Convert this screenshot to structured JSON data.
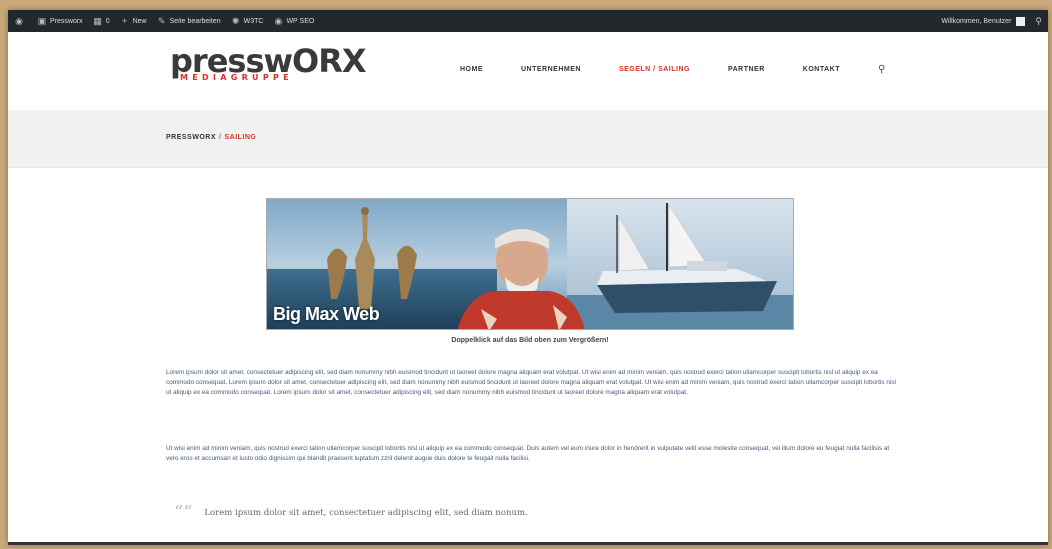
{
  "adminbar": {
    "items": [
      {
        "icon": "wordpress-icon",
        "label": ""
      },
      {
        "icon": "dashboard-icon",
        "label": "Pressworx"
      },
      {
        "icon": "comments-icon",
        "label": "0"
      },
      {
        "icon": "plus-icon",
        "label": "New"
      },
      {
        "icon": "edit-icon",
        "label": "Seite bearbeiten"
      },
      {
        "icon": "w3tc-icon",
        "label": "W3TC"
      },
      {
        "icon": "seo-icon",
        "label": "WP SEO"
      }
    ],
    "greeting": "Willkommen, Benutzer"
  },
  "header": {
    "logo_main": "presswORX",
    "logo_sub": "MEDIAGRUPPE",
    "nav": [
      {
        "label": "HOME",
        "active": false
      },
      {
        "label": "UNTERNEHMEN",
        "active": false
      },
      {
        "label": "SEGELN / SAILING",
        "active": true
      },
      {
        "label": "PARTNER",
        "active": false
      },
      {
        "label": "KONTAKT",
        "active": false
      }
    ]
  },
  "breadcrumb": {
    "home": "PRESSWORX",
    "separator": "/",
    "current": "SAILING"
  },
  "content": {
    "banner_text": "Big Max Web",
    "caption": "Doppelklick auf das Bild oben zum Vergrößern!",
    "paragraph1": "Lorem ipsum dolor sit amet, consectetuer adipiscing elit, sed diam nonummy nibh euismod tincidunt ut laoreet dolore magna aliquam erat volutpat. Ut wisi enim ad minim veniam, quis nostrud exerci tation ullamcorper suscipit lobortis nisl ut aliquip ex ea commodo consequat. Lorem ipsum dolor sit amet, consectetuer adipiscing elit, sed diam nonummy nibh euismod tincidunt ut laoreet dolore magna aliquam erat volutpat. Ut wisi enim ad minim veniam, quis nostrud exerci tation ullamcorper suscipit lobortis nisl ut aliquip ex ea commodo consequat. Lorem ipsum dolor sit amet, consectetuer adipiscing elit, sed diam nonummy nibh euismod tincidunt ut laoreet dolore magna aliquam erat volutpat.",
    "paragraph2": "Ut wisi enim ad minim veniam, quis nostrud exerci tation ullamcorper suscipit lobortis nisl ut aliquip ex ea commodo consequat. Duis autem vel eum iriure dolor in hendrerit in vulputate velit esse molestie consequat, vel illum dolore eu feugiat nulla facilisis at vero eros et accumsan et iusto odio dignissim qui blandit praesent luptatum zzril delenit augue duis dolore te feugait nulla facilisi.",
    "quote": "Lorem ipsum dolor sit amet, consectetuer adipiscing elit, sed diam nonum."
  },
  "colors": {
    "accent": "#d93025",
    "adminbar": "#23282d",
    "band": "#f1f1f1",
    "body_text": "#4a5a78"
  }
}
